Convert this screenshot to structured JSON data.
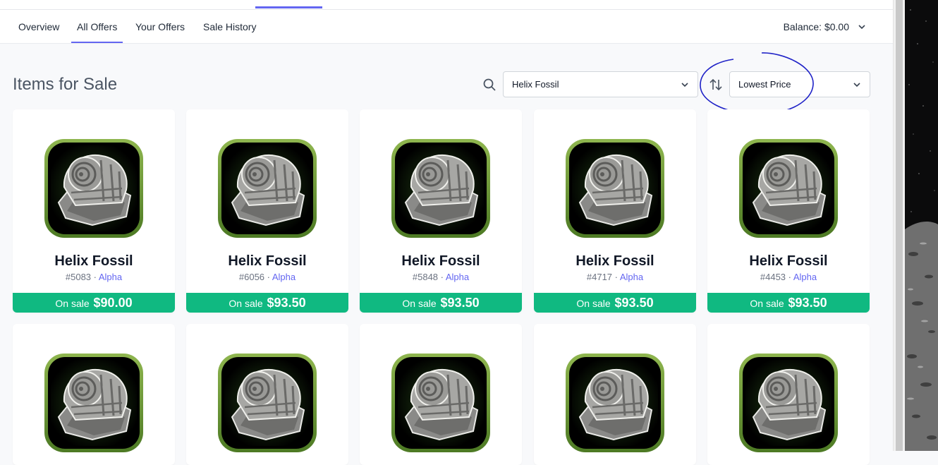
{
  "nav": {
    "tabs": [
      {
        "label": "Overview"
      },
      {
        "label": "All Offers"
      },
      {
        "label": "Your Offers"
      },
      {
        "label": "Sale History"
      }
    ],
    "balance": "Balance: $0.00"
  },
  "page": {
    "title": "Items for Sale",
    "search_value": "Helix Fossil",
    "sort_value": "Lowest Price"
  },
  "colors": {
    "accent": "#6366f1",
    "sale": "#10b981"
  },
  "icons": [
    "search-icon",
    "chevron-down-icon",
    "sort-arrows-icon",
    "helix-fossil-icon"
  ],
  "items": [
    {
      "name": "Helix Fossil",
      "id": "#5083",
      "rarity": "Alpha",
      "on_sale": "On sale",
      "price": "$90.00"
    },
    {
      "name": "Helix Fossil",
      "id": "#6056",
      "rarity": "Alpha",
      "on_sale": "On sale",
      "price": "$93.50"
    },
    {
      "name": "Helix Fossil",
      "id": "#5848",
      "rarity": "Alpha",
      "on_sale": "On sale",
      "price": "$93.50"
    },
    {
      "name": "Helix Fossil",
      "id": "#4717",
      "rarity": "Alpha",
      "on_sale": "On sale",
      "price": "$93.50"
    },
    {
      "name": "Helix Fossil",
      "id": "#4453",
      "rarity": "Alpha",
      "on_sale": "On sale",
      "price": "$93.50"
    }
  ]
}
